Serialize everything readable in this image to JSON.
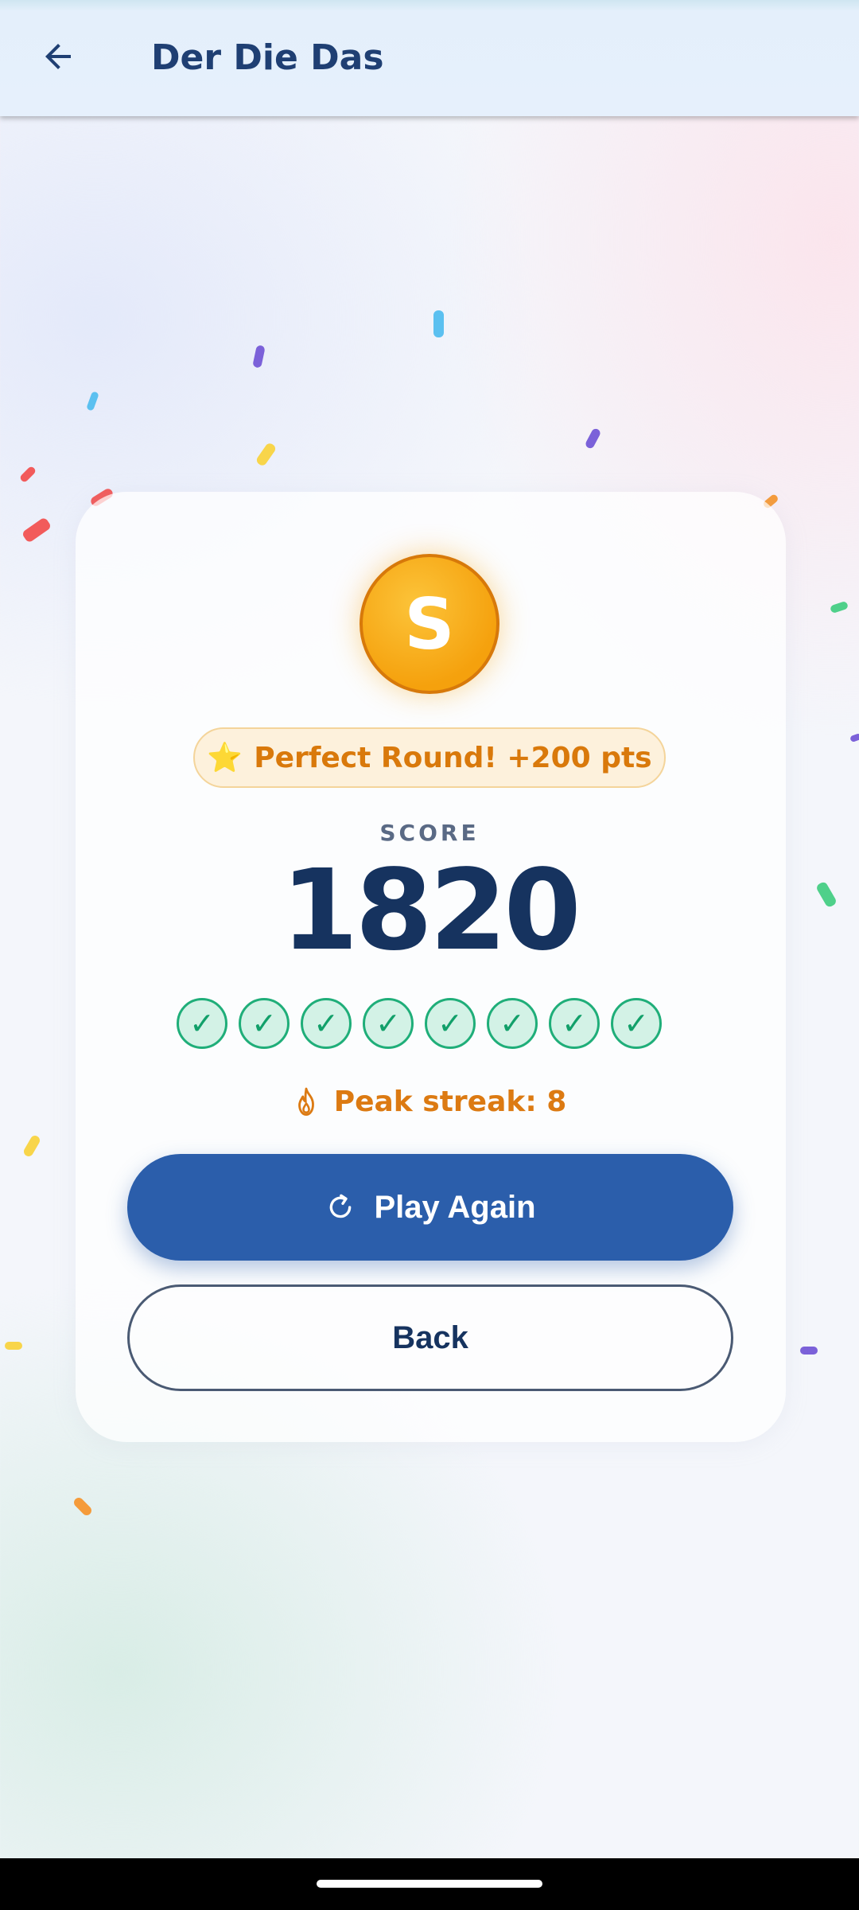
{
  "header": {
    "title": "Der Die Das",
    "back_icon": "arrow-left-icon"
  },
  "result": {
    "medal_letter": "S",
    "bonus_icon": "⭐",
    "bonus_text": "Perfect Round! +200 pts",
    "score_label": "SCORE",
    "score_value": "1820",
    "answers": [
      {
        "correct": true,
        "symbol": "✓"
      },
      {
        "correct": true,
        "symbol": "✓"
      },
      {
        "correct": true,
        "symbol": "✓"
      },
      {
        "correct": true,
        "symbol": "✓"
      },
      {
        "correct": true,
        "symbol": "✓"
      },
      {
        "correct": true,
        "symbol": "✓"
      },
      {
        "correct": true,
        "symbol": "✓"
      },
      {
        "correct": true,
        "symbol": "✓"
      }
    ],
    "streak_text": "Peak streak: 8"
  },
  "actions": {
    "play_again_label": "Play Again",
    "back_label": "Back"
  },
  "colors": {
    "primary": "#2b5eab",
    "title": "#1f3f73",
    "score": "#16335f",
    "accent_orange": "#d9790b",
    "success": "#1fae79",
    "medal": "#f5a10d"
  },
  "confetti_colors": [
    "#5bc0f0",
    "#7b61d9",
    "#f25b5b",
    "#f8d54a",
    "#f59b3a",
    "#4fd08a"
  ]
}
